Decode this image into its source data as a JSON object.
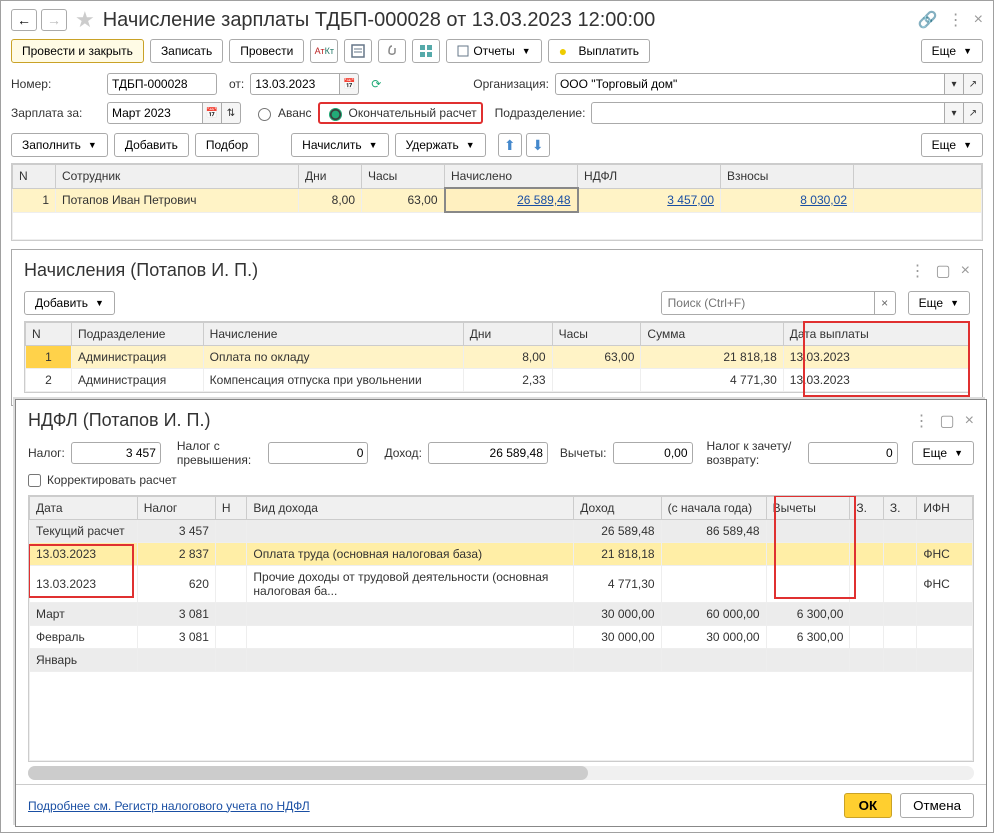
{
  "title": "Начисление зарплаты ТДБП-000028 от 13.03.2023 12:00:00",
  "toolbar": {
    "post_close": "Провести и закрыть",
    "save": "Записать",
    "post": "Провести",
    "reports": "Отчеты",
    "pay": "Выплатить",
    "more": "Еще"
  },
  "fields": {
    "number_label": "Номер:",
    "number_value": "ТДБП-000028",
    "date_label": "от:",
    "date_value": "13.03.2023",
    "org_label": "Организация:",
    "org_value": "ООО \"Торговый дом\"",
    "salary_for_label": "Зарплата за:",
    "salary_for_value": "Март 2023",
    "advance_label": "Аванс",
    "final_label": "Окончательный расчет",
    "dept_label": "Подразделение:",
    "dept_value": ""
  },
  "actions": {
    "fill": "Заполнить",
    "add": "Добавить",
    "pickup": "Подбор",
    "accrue": "Начислить",
    "withhold": "Удержать",
    "more": "Еще"
  },
  "main_table": {
    "headers": {
      "n": "N",
      "emp": "Сотрудник",
      "days": "Дни",
      "hours": "Часы",
      "accrued": "Начислено",
      "ndfl": "НДФЛ",
      "contrib": "Взносы"
    },
    "rows": [
      {
        "n": "1",
        "emp": "Потапов Иван Петрович",
        "days": "8,00",
        "hours": "63,00",
        "accrued": "26 589,48",
        "ndfl": "3 457,00",
        "contrib": "8 030,02"
      }
    ]
  },
  "accruals_panel": {
    "title": "Начисления (Потапов И. П.)",
    "add_btn": "Добавить",
    "search_placeholder": "Поиск (Ctrl+F)",
    "more": "Еще",
    "headers": {
      "n": "N",
      "dept": "Подразделение",
      "accrual": "Начисление",
      "days": "Дни",
      "hours": "Часы",
      "sum": "Сумма",
      "paydate": "Дата выплаты"
    },
    "rows": [
      {
        "n": "1",
        "dept": "Администрация",
        "accrual": "Оплата по окладу",
        "days": "8,00",
        "hours": "63,00",
        "sum": "21 818,18",
        "paydate": "13.03.2023"
      },
      {
        "n": "2",
        "dept": "Администрация",
        "accrual": "Компенсация отпуска при увольнении",
        "days": "2,33",
        "hours": "",
        "sum": "4 771,30",
        "paydate": "13.03.2023"
      }
    ]
  },
  "ndfl_panel": {
    "title": "НДФЛ (Потапов И. П.)",
    "tax_label": "Налог:",
    "tax_value": "3 457",
    "excess_label": "Налог с превышения:",
    "excess_value": "0",
    "income_label": "Доход:",
    "income_value": "26 589,48",
    "deduct_label": "Вычеты:",
    "deduct_value": "0,00",
    "refund_label": "Налог к зачету/возврату:",
    "refund_value": "0",
    "more": "Еще",
    "adjust_label": "Корректировать расчет",
    "headers": {
      "date": "Дата",
      "tax": "Налог",
      "n": "Н",
      "income_type": "Вид дохода",
      "income": "Доход",
      "ytd": "(с начала года)",
      "deductions": "Вычеты",
      "z1": "З.",
      "z2": "З.",
      "ifn": "ИФН"
    },
    "rows": [
      {
        "date": "Текущий расчет",
        "tax": "3 457",
        "n": "",
        "income_type": "",
        "income": "26 589,48",
        "ytd": "86 589,48",
        "deductions": "",
        "z1": "",
        "z2": "",
        "ifn": "",
        "grey": true
      },
      {
        "date": "13.03.2023",
        "tax": "2 837",
        "n": "",
        "income_type": "Оплата труда (основная налоговая база)",
        "income": "21 818,18",
        "ytd": "",
        "deductions": "",
        "z1": "",
        "z2": "",
        "ifn": "ФНС",
        "sel": true
      },
      {
        "date": "13.03.2023",
        "tax": "620",
        "n": "",
        "income_type": "Прочие доходы от трудовой деятельности (основная налоговая ба...",
        "income": "4 771,30",
        "ytd": "",
        "deductions": "",
        "z1": "",
        "z2": "",
        "ifn": "ФНС"
      },
      {
        "date": "Март",
        "tax": "3 081",
        "n": "",
        "income_type": "",
        "income": "30 000,00",
        "ytd": "60 000,00",
        "deductions": "6 300,00",
        "z1": "",
        "z2": "",
        "ifn": "",
        "grey": true
      },
      {
        "date": "Февраль",
        "tax": "3 081",
        "n": "",
        "income_type": "",
        "income": "30 000,00",
        "ytd": "30 000,00",
        "deductions": "6 300,00",
        "z1": "",
        "z2": "",
        "ifn": ""
      },
      {
        "date": "Январь",
        "tax": "",
        "n": "",
        "income_type": "",
        "income": "",
        "ytd": "",
        "deductions": "",
        "z1": "",
        "z2": "",
        "ifn": "",
        "grey": true
      }
    ],
    "link": "Подробнее см. Регистр налогового учета по НДФЛ",
    "ok": "ОК",
    "cancel": "Отмена"
  }
}
